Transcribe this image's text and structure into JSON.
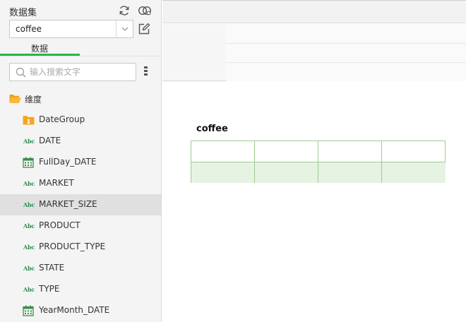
{
  "panel": {
    "title": "数据集",
    "dataset_value": "coffee",
    "tab_label": "数据",
    "search_placeholder": "输入搜索文字",
    "dimension_label": "维度",
    "accent_color": "#2db34a"
  },
  "fields": [
    {
      "label": "DateGroup",
      "icon": "folder-group-icon",
      "selected": false
    },
    {
      "label": "DATE",
      "icon": "abc-icon",
      "selected": false
    },
    {
      "label": "FullDay_DATE",
      "icon": "calendar-icon",
      "selected": false
    },
    {
      "label": "MARKET",
      "icon": "abc-icon",
      "selected": false
    },
    {
      "label": "MARKET_SIZE",
      "icon": "abc-icon",
      "selected": true
    },
    {
      "label": "PRODUCT",
      "icon": "abc-icon",
      "selected": false
    },
    {
      "label": "PRODUCT_TYPE",
      "icon": "abc-icon",
      "selected": false
    },
    {
      "label": "STATE",
      "icon": "abc-icon",
      "selected": false
    },
    {
      "label": "TYPE",
      "icon": "abc-icon",
      "selected": false
    },
    {
      "label": "YearMonth_DATE",
      "icon": "calendar-icon",
      "selected": false
    }
  ],
  "abc_text": "Abc",
  "table": {
    "title": "coffee",
    "border_color": "#9ccc8f",
    "fill_color": "#e6f3e2"
  }
}
